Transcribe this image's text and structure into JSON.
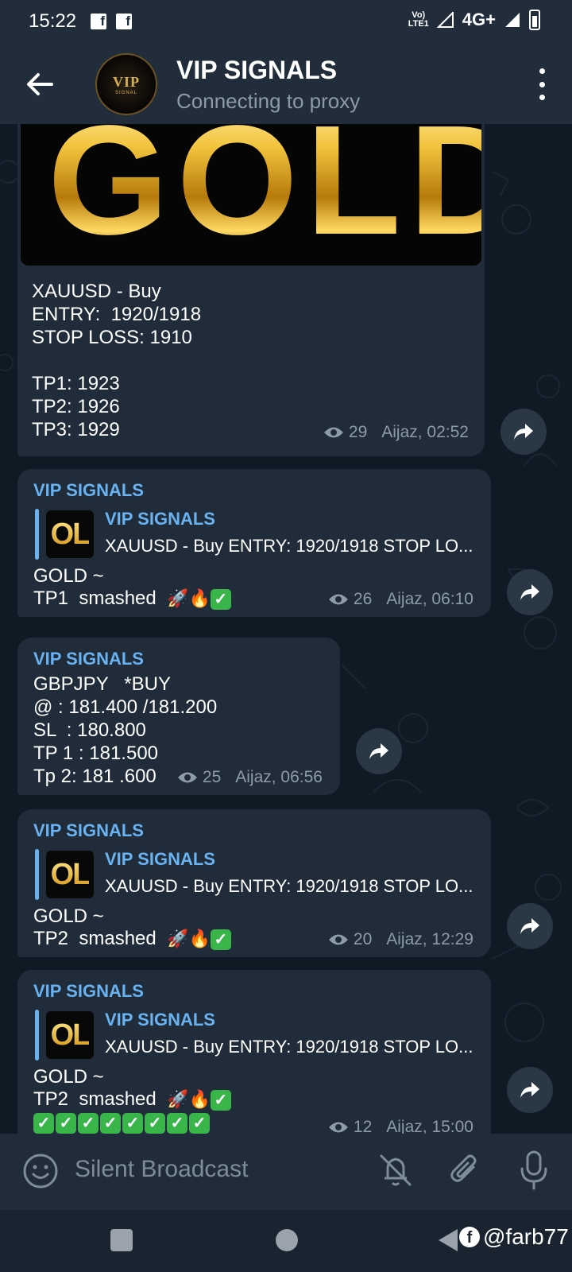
{
  "status_bar": {
    "time": "15:22",
    "network": "4G+",
    "volte": "Vo) LTE1"
  },
  "header": {
    "title": "VIP SIGNALS",
    "subtitle": "Connecting to proxy",
    "avatar_text": "VIP",
    "avatar_subtext": "SIGNAL"
  },
  "messages": [
    {
      "type": "photo",
      "image_text": "GOLD",
      "text": "XAUUSD - Buy\nENTRY:  1920/1918\nSTOP LOSS: 1910\n\nTP1: 1923\nTP2: 1926\nTP3: 1929",
      "views": "29",
      "author_time": "Aijaz, 02:52"
    },
    {
      "type": "reply",
      "sender": "VIP SIGNALS",
      "reply_title": "VIP SIGNALS",
      "reply_text": "XAUUSD - Buy ENTRY:  1920/1918 STOP LO...",
      "reply_thumb": "OL",
      "text_line1": "GOLD ~",
      "text_line2": "TP1  smashed",
      "emoji": "🚀🔥",
      "views": "26",
      "author_time": "Aijaz, 06:10"
    },
    {
      "type": "text",
      "sender": "VIP SIGNALS",
      "text": "GBPJPY   *BUY\n@ : 181.400 /181.200\nSL  : 180.800\nTP 1 : 181.500\nTp 2: 181 .600",
      "views": "25",
      "author_time": "Aijaz, 06:56"
    },
    {
      "type": "reply",
      "sender": "VIP SIGNALS",
      "reply_title": "VIP SIGNALS",
      "reply_text": "XAUUSD - Buy ENTRY:  1920/1918 STOP LO...",
      "reply_thumb": "OL",
      "text_line1": "GOLD ~",
      "text_line2": "TP2  smashed",
      "emoji": "🚀🔥",
      "views": "20",
      "author_time": "Aijaz, 12:29"
    },
    {
      "type": "reply",
      "sender": "VIP SIGNALS",
      "reply_title": "VIP SIGNALS",
      "reply_text": "XAUUSD - Buy ENTRY:  1920/1918 STOP LO...",
      "reply_thumb": "OL",
      "text_line1": "GOLD ~",
      "text_line2": "TP2  smashed",
      "emoji": "🚀🔥",
      "check_count": 8,
      "views": "12",
      "author_time": "Aijaz, 15:00"
    }
  ],
  "input": {
    "placeholder": "Silent Broadcast"
  },
  "watermark": "@farb77",
  "colors": {
    "accent": "#6ab3f3",
    "bubble": "#202c39",
    "background": "#0f1a24",
    "bar": "#212d3b"
  }
}
